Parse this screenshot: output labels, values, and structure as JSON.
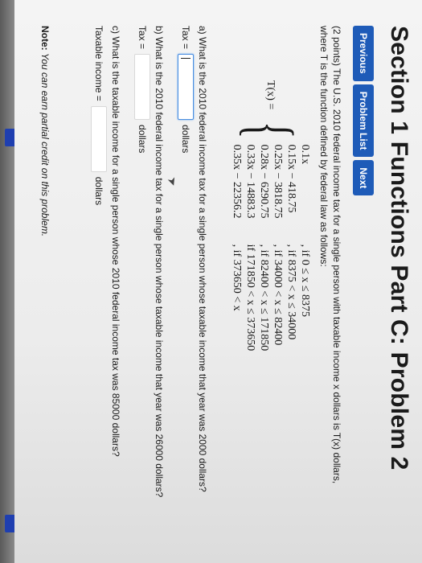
{
  "title": "Section 1 Functions Part C: Problem 2",
  "nav": {
    "previous": "Previous",
    "problem_list": "Problem List",
    "next": "Next"
  },
  "problem": {
    "intro_line1": "(2 points) The U.S. 2010 federal income tax for a single person with taxable income x dollars is T(x) dollars,",
    "intro_line2": "where T is the function defined by federal law as follows:",
    "function_name": "T(x) =",
    "cases": [
      {
        "expr": "0.1x",
        "cond": ", if 0 ≤ x ≤ 8375"
      },
      {
        "expr": "0.15x − 418.75",
        "cond": ", if 8375 < x ≤ 34000"
      },
      {
        "expr": "0.25x − 3818.75",
        "cond": ", if 34000 < x ≤ 82400"
      },
      {
        "expr": "0.28x − 6290.75",
        "cond": ", if 82400 < x ≤ 171850"
      },
      {
        "expr": "0.33x − 14883.3",
        "cond": "if 171850 < x ≤ 373650"
      },
      {
        "expr": "0.35x − 22356.2",
        "cond": ", if 373650 < x"
      }
    ]
  },
  "questions": {
    "a": {
      "text": "a) What is the 2010 federal income tax for a single person whose taxable income that year was 2000 dollars?",
      "label": "Tax =",
      "value": "",
      "unit": "dollars"
    },
    "b": {
      "text": "b) What is the 2010 federal income tax for a single person whose taxable income that year was 26000 dollars?",
      "label": "Tax =",
      "value": "",
      "unit": "dollars"
    },
    "c": {
      "text": "c) What is the taxable income for a single person whose 2010 federal income tax was 85000 dollars?",
      "label": "Taxable income =",
      "value": "",
      "unit": "dollars"
    }
  },
  "note": {
    "label": "Note:",
    "text": "You can earn partial credit on this problem."
  },
  "colors": {
    "button": "#1e5bb8",
    "active_field_border": "#4a8ee0"
  }
}
